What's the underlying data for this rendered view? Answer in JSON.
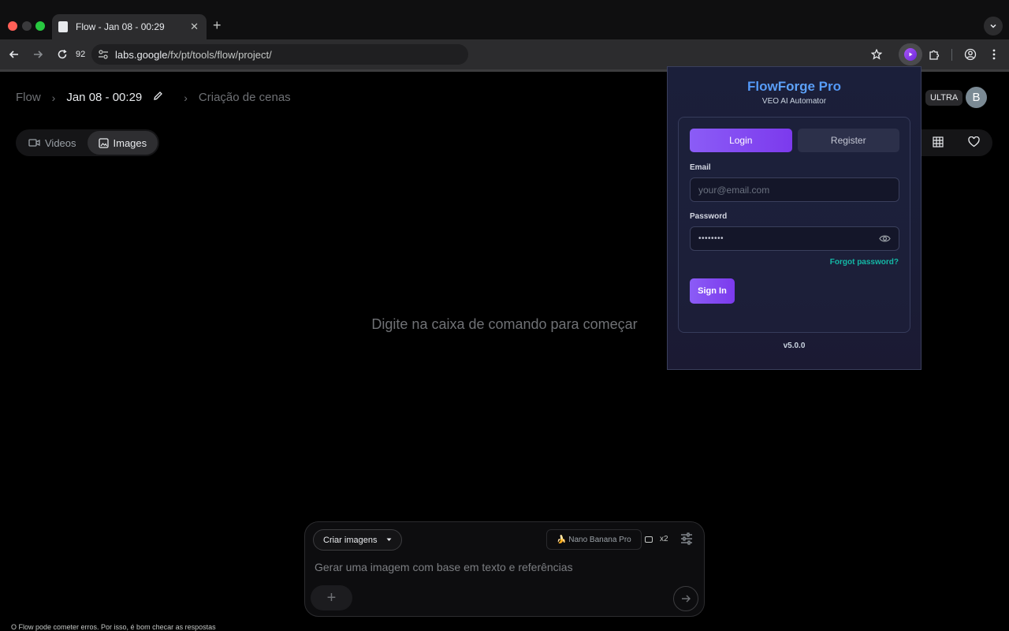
{
  "browser": {
    "tab_title": "Flow - Jan 08 - 00:29",
    "zoom_level": "92",
    "url_host": "labs.google",
    "url_path": "/fx/pt/tools/flow/project/"
  },
  "breadcrumb": {
    "root": "Flow",
    "current": "Jan 08 - 00:29",
    "next": "Criação de cenas"
  },
  "media_tabs": [
    {
      "label": "Videos",
      "active": false
    },
    {
      "label": "Images",
      "active": true
    }
  ],
  "account": {
    "plan_badge": "ULTRA",
    "avatar_initial": "B"
  },
  "empty_state": "Digite na caixa de comando para começar",
  "composer": {
    "mode_label": "Criar imagens",
    "model_label": "🍌 Nano Banana Pro",
    "count_label": "x2",
    "placeholder": "Gerar uma imagem com base em texto e referências"
  },
  "footer_note": "O Flow pode cometer erros. Por isso, é bom checar as respostas",
  "popup": {
    "title": "FlowForge Pro",
    "subtitle": "VEO AI Automator",
    "tab_login": "Login",
    "tab_register": "Register",
    "email_label": "Email",
    "email_placeholder": "your@email.com",
    "password_label": "Password",
    "password_value": "••••••••",
    "forgot": "Forgot password?",
    "signin": "Sign In",
    "version": "v5.0.0",
    "accent": "#8b5cf6"
  }
}
